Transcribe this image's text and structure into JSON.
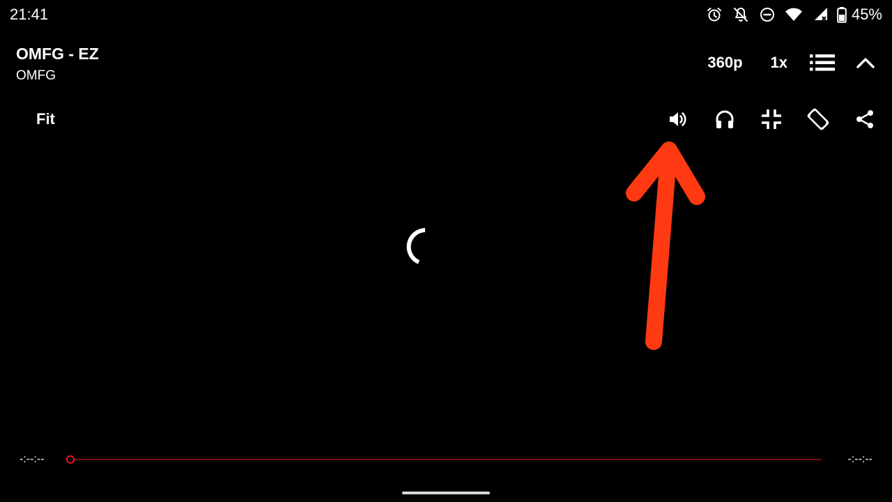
{
  "status_bar": {
    "time": "21:41",
    "battery_percent": "45%",
    "icons": [
      "alarm-icon",
      "notifications-off-icon",
      "do-not-disturb-icon",
      "wifi-icon",
      "battery-icon"
    ]
  },
  "video": {
    "title": "OMFG - EZ",
    "channel": "OMFG"
  },
  "top_controls": {
    "quality": "360p",
    "speed": "1x",
    "icons": [
      "queue-list-icon",
      "chevron-up-icon"
    ]
  },
  "second_row": {
    "fit_label": "Fit",
    "icons": [
      "volume-icon",
      "headphones-icon",
      "exit-fullscreen-icon",
      "screen-rotation-icon",
      "share-icon"
    ]
  },
  "player": {
    "state": "loading",
    "annotation": "red-arrow-pointing-to-volume-icon"
  },
  "seekbar": {
    "current_time": "-:--:--",
    "total_time": "-:--:--",
    "progress": 0
  },
  "colors": {
    "background": "#000000",
    "accent": "#e8161b",
    "annotation_arrow": "#ff3a12",
    "text": "#ffffff"
  }
}
